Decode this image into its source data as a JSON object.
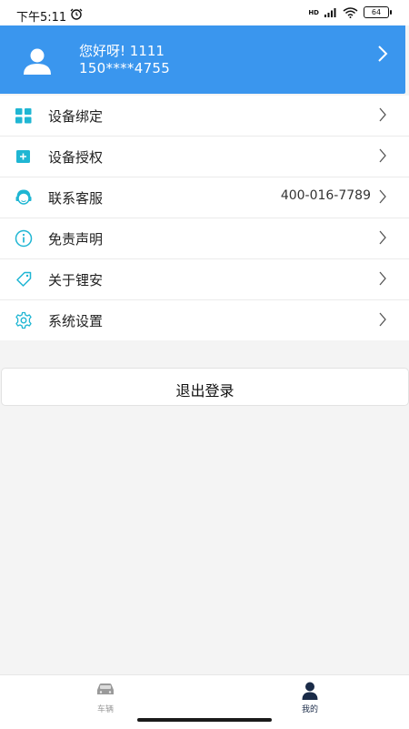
{
  "status_bar": {
    "time": "下午5:11",
    "network": "HD",
    "battery": "64"
  },
  "profile": {
    "greeting": "您好呀! 1111",
    "phone": "150****4755"
  },
  "menu": [
    {
      "label": "设备绑定",
      "value": "",
      "icon": "grid-icon"
    },
    {
      "label": "设备授权",
      "value": "",
      "icon": "plus-square-icon"
    },
    {
      "label": "联系客服",
      "value": "400-016-7789",
      "icon": "customer-service-icon"
    },
    {
      "label": "免责声明",
      "value": "",
      "icon": "info-icon"
    },
    {
      "label": "关于锂安",
      "value": "",
      "icon": "tag-icon"
    },
    {
      "label": "系统设置",
      "value": "",
      "icon": "gear-icon"
    }
  ],
  "logout": {
    "label": "退出登录"
  },
  "tabs": [
    {
      "label": "车辆",
      "icon": "car-icon",
      "active": false
    },
    {
      "label": "我的",
      "icon": "person-icon",
      "active": true
    }
  ],
  "colors": {
    "header": "#3a96ee",
    "accent": "#1fb6d3",
    "tab_active": "#1a2b48",
    "tab_inactive": "#9a9a9a"
  }
}
